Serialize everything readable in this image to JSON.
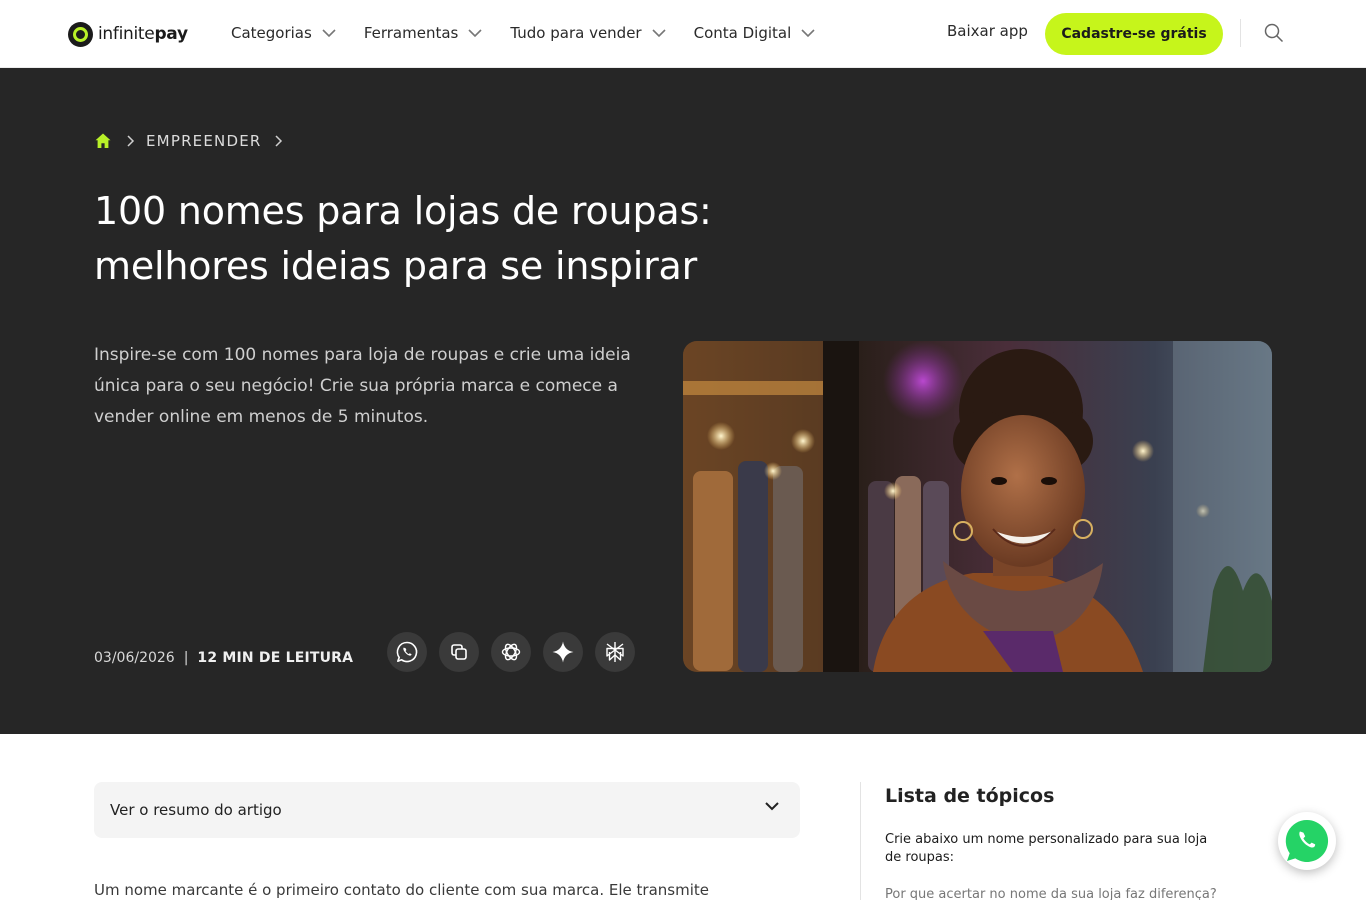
{
  "brand": {
    "name_light": "infinite",
    "name_bold": "pay",
    "accent": "#c6f51b"
  },
  "nav": {
    "items": [
      {
        "label": "Categorias"
      },
      {
        "label": "Ferramentas"
      },
      {
        "label": "Tudo para vender"
      },
      {
        "label": "Conta Digital"
      }
    ],
    "download_label": "Baixar app",
    "signup_label": "Cadastre-se grátis",
    "search_icon": "search-icon"
  },
  "hero": {
    "breadcrumb": {
      "home_icon": "home-icon",
      "category": "EMPREENDER"
    },
    "title": "100 nomes para lojas de roupas: melhores ideias para se inspirar",
    "lead": "Inspire-se com 100 nomes para loja de roupas e crie uma ideia única para o seu negócio! Crie sua própria marca e comece a vender online em menos de 5 minutos.",
    "date": "03/06/2026",
    "separator": "|",
    "read_time": "12 MIN DE LEITURA",
    "share_icons": [
      "whatsapp-icon",
      "copy-link-icon",
      "chatgpt-icon",
      "gemini-icon",
      "perplexity-icon"
    ],
    "background": "#262626"
  },
  "article": {
    "summary_label": "Ver o resumo do artigo",
    "intro": "Um nome marcante é o primeiro contato do cliente com sua marca. Ele transmite"
  },
  "toc": {
    "title": "Lista de tópicos",
    "items": [
      "Crie abaixo um nome personalizado para sua loja de roupas:",
      "Por que acertar no nome da sua loja faz diferença?"
    ]
  },
  "floating": {
    "icon": "whatsapp-icon",
    "color": "#25d366"
  }
}
